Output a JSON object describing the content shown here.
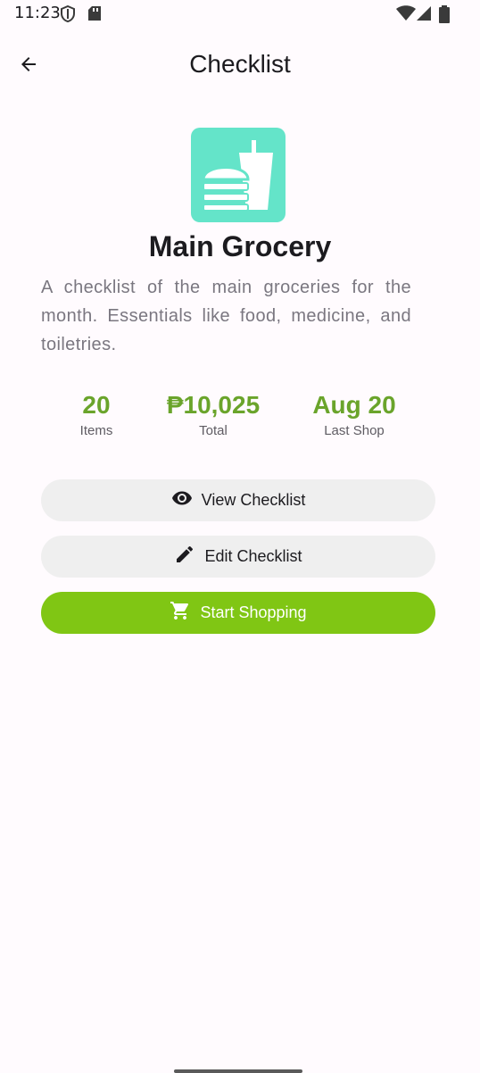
{
  "status_bar": {
    "time": "11:23",
    "icons": [
      "shield-icon",
      "sd-card-icon",
      "wifi-icon",
      "signal-icon",
      "battery-icon"
    ]
  },
  "header": {
    "title": "Checklist",
    "back_icon": "arrow-back-icon"
  },
  "checklist": {
    "icon": "fastfood-icon",
    "icon_color": "#64e4c9",
    "name": "Main Grocery",
    "description": "A checklist of the main groceries for the month. Essentials like food, medicine, and toiletries."
  },
  "stats": [
    {
      "value": "20",
      "label": "Items"
    },
    {
      "value": "₱10,025",
      "label": "Total"
    },
    {
      "value": "Aug 20",
      "label": "Last Shop"
    }
  ],
  "actions": {
    "view_label": "View Checklist",
    "edit_label": "Edit Checklist",
    "start_label": "Start Shopping"
  },
  "colors": {
    "accent": "#80c614",
    "stat_green": "#6aa42b",
    "button_light": "#efefef"
  }
}
